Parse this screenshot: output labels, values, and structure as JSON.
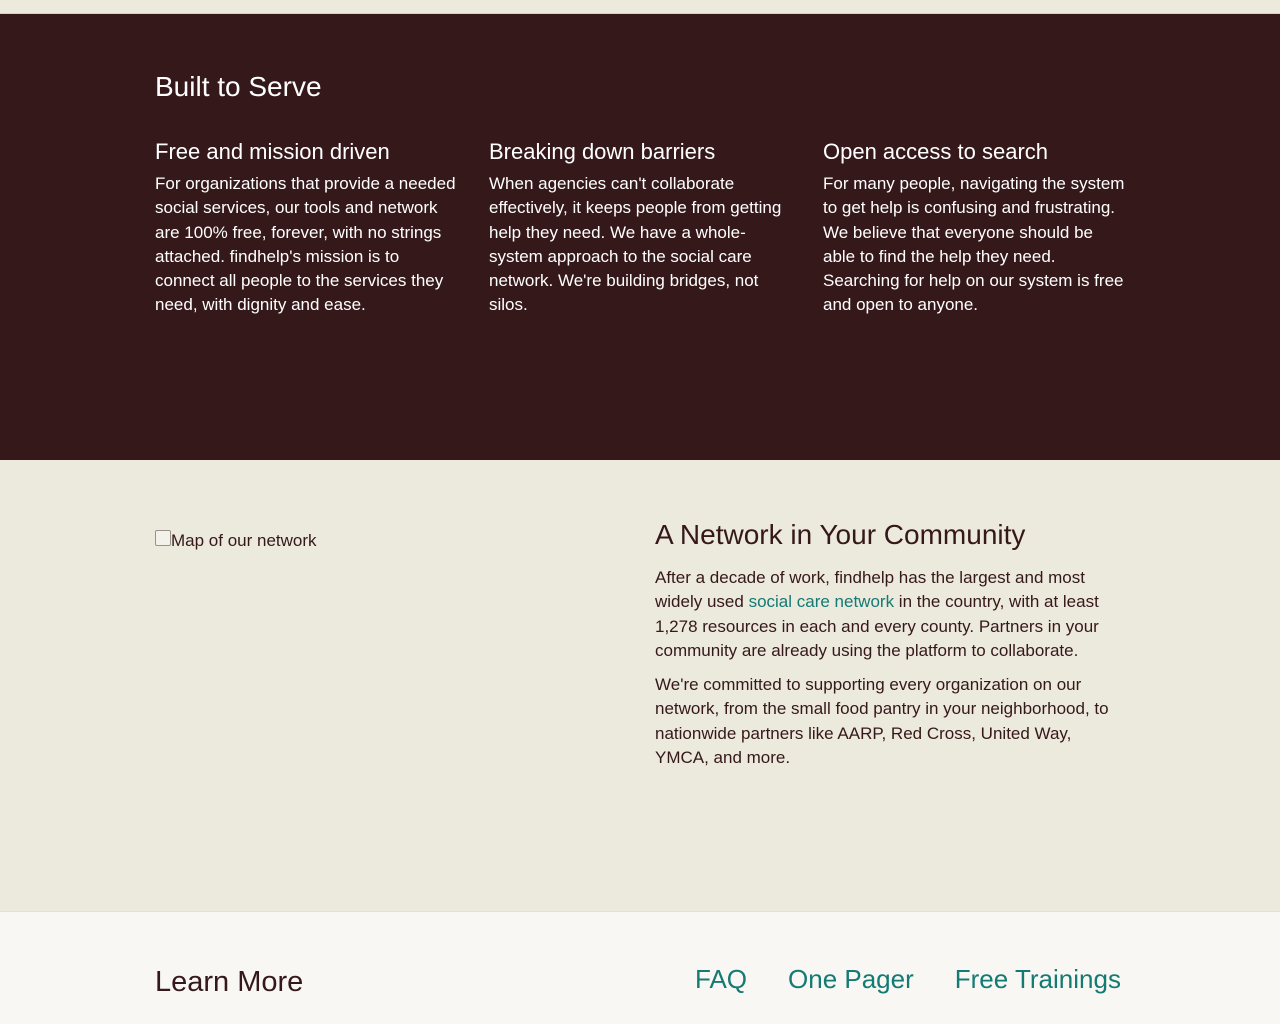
{
  "serve": {
    "title": "Built to Serve",
    "columns": [
      {
        "heading": "Free and mission driven",
        "body": "For organizations that provide a needed social services, our tools and network are 100% free, forever, with no strings attached. findhelp's mission is to connect all people to the services they need, with dignity and ease."
      },
      {
        "heading": "Breaking down barriers",
        "body": "When agencies can't collaborate effectively, it keeps people from getting help they need. We have a whole-system approach to the social care network. We're building bridges, not silos."
      },
      {
        "heading": "Open access to search",
        "body": "For many people, navigating the system to get help is confusing and frustrating. We believe that everyone should be able to find the help they need. Searching for help on our system is free and open to anyone."
      }
    ]
  },
  "network": {
    "map_alt": "Map of our network",
    "title": "A Network in Your Community",
    "p1_before": "After a decade of work, findhelp has the largest and most widely used ",
    "p1_link": "social care network",
    "p1_after": " in the country, with at least 1,278 resources in each and every county. Partners in your community are already using the platform to collaborate.",
    "p2": "We're committed to supporting every organization on our network, from the small food pantry in your neighborhood, to nationwide partners like AARP, Red Cross, United Way, YMCA, and more."
  },
  "learn": {
    "title": "Learn More",
    "links": [
      "FAQ",
      "One Pager",
      "Free Trainings"
    ]
  },
  "colors": {
    "dark": "#35181a",
    "beige": "#ece9dd",
    "light": "#f8f7f3",
    "link": "#137a74"
  }
}
